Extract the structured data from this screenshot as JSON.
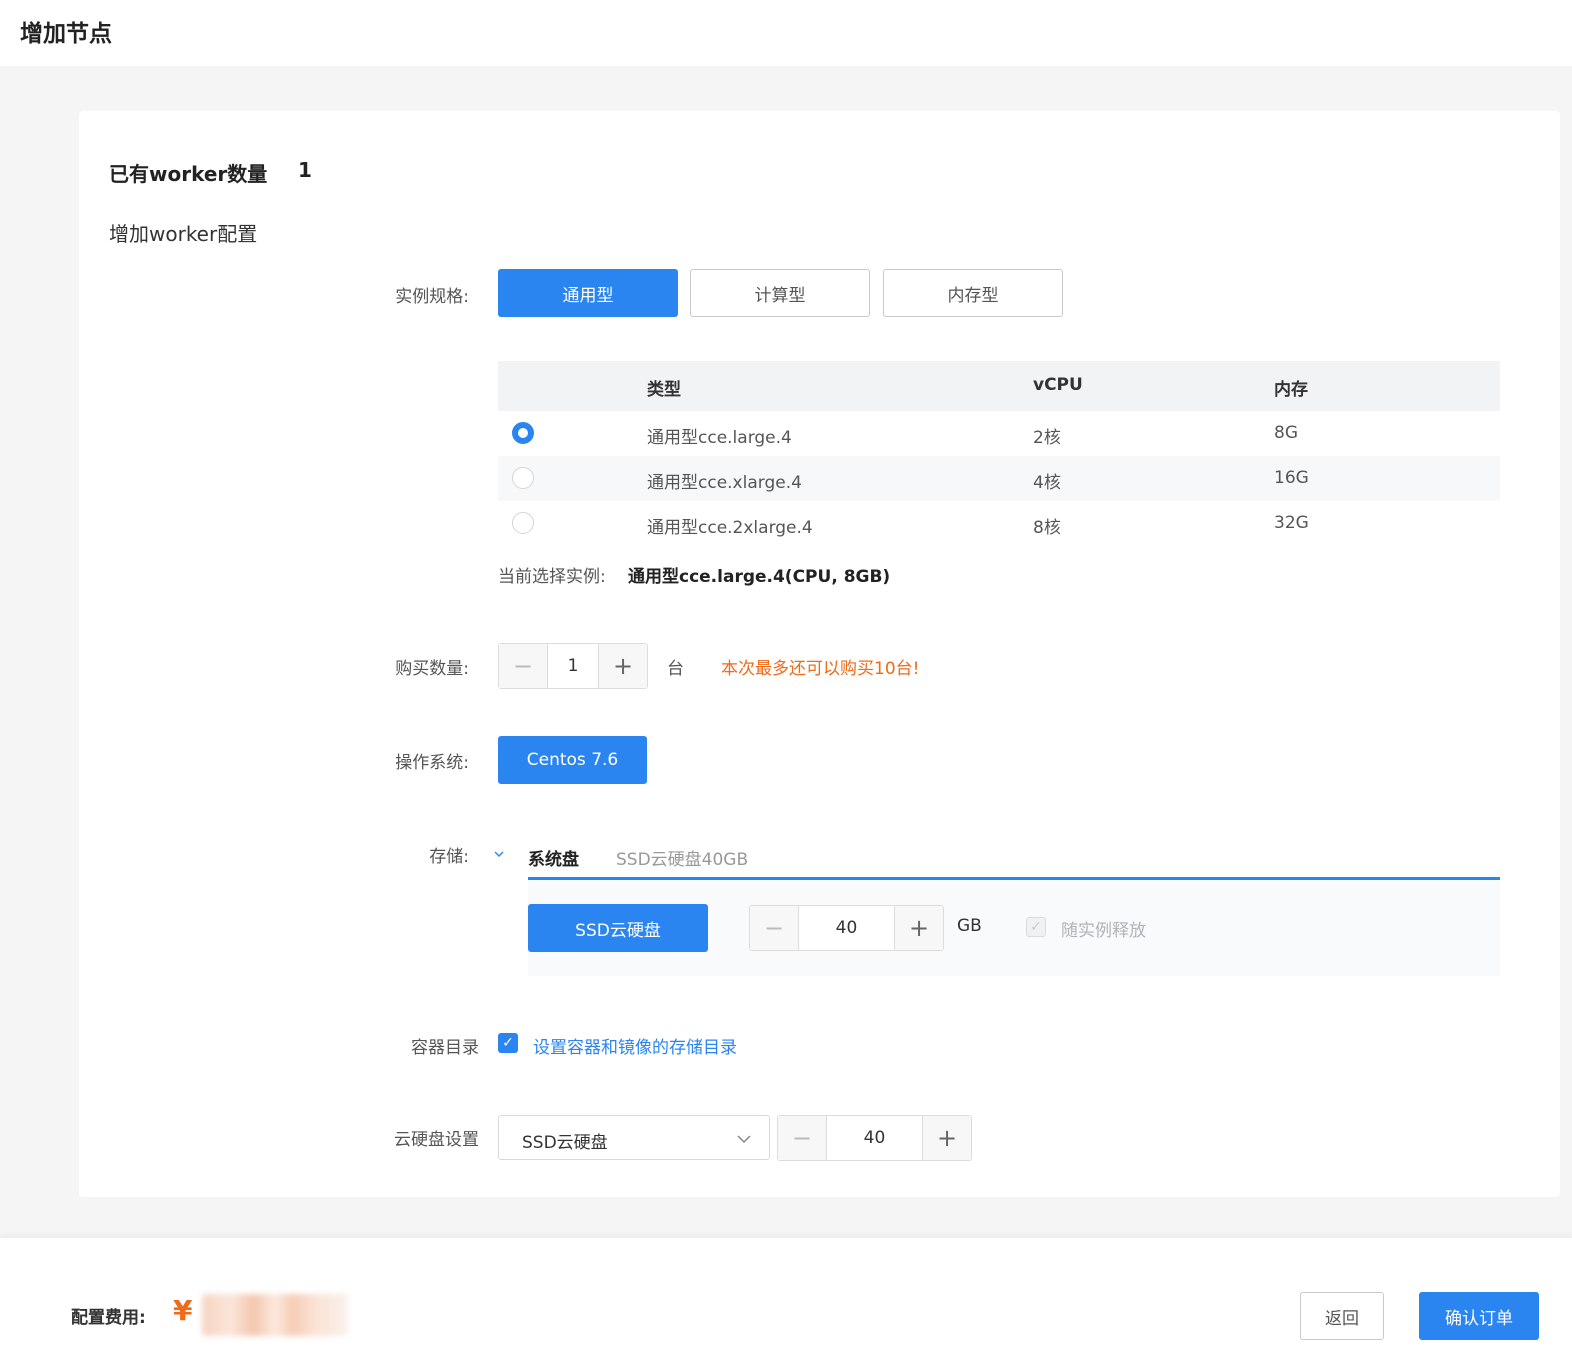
{
  "page": {
    "title": "增加节点"
  },
  "summary": {
    "existing_workers_label": "已有worker数量",
    "existing_workers_count": "1",
    "add_config_label": "增加worker配置"
  },
  "instance_spec": {
    "label": "实例规格:",
    "types": [
      "通用型",
      "计算型",
      "内存型"
    ],
    "selected_type": "通用型",
    "table": {
      "headers": [
        "类型",
        "vCPU",
        "内存"
      ],
      "rows": [
        {
          "name": "通用型cce.large.4",
          "vcpu": "2核",
          "memory": "8G",
          "selected": true
        },
        {
          "name": "通用型cce.xlarge.4",
          "vcpu": "4核",
          "memory": "16G",
          "selected": false
        },
        {
          "name": "通用型cce.2xlarge.4",
          "vcpu": "8核",
          "memory": "32G",
          "selected": false
        }
      ]
    },
    "current_label": "当前选择实例:",
    "current_value": "通用型cce.large.4(CPU, 8GB)"
  },
  "purchase": {
    "label": "购买数量:",
    "minus": "−",
    "value": "1",
    "plus": "+",
    "unit": "台",
    "hint": "本次最多还可以购买10台!"
  },
  "os": {
    "label": "操作系统:",
    "selected": "Centos 7.6"
  },
  "storage": {
    "label": "存储:",
    "collapse_icon": "chevron-down",
    "tab_active": "系统盘",
    "tab_summary": "SSD云硬盘40GB",
    "disk_type": "SSD云硬盘",
    "minus": "−",
    "size": "40",
    "plus": "+",
    "unit": "GB",
    "release_with_instance": "随实例释放",
    "release_checked": true
  },
  "container_dir": {
    "label": "容器目录",
    "checked": true,
    "link": "设置容器和镜像的存储目录"
  },
  "cloud_disk": {
    "label": "云硬盘设置",
    "type": "SSD云硬盘",
    "minus": "−",
    "size": "40",
    "plus": "+"
  },
  "footer": {
    "fee_label": "配置费用:",
    "currency": "¥",
    "back_button": "返回",
    "confirm_button": "确认订单"
  },
  "colors": {
    "primary": "#2b85f0",
    "warning": "#f06a17"
  }
}
